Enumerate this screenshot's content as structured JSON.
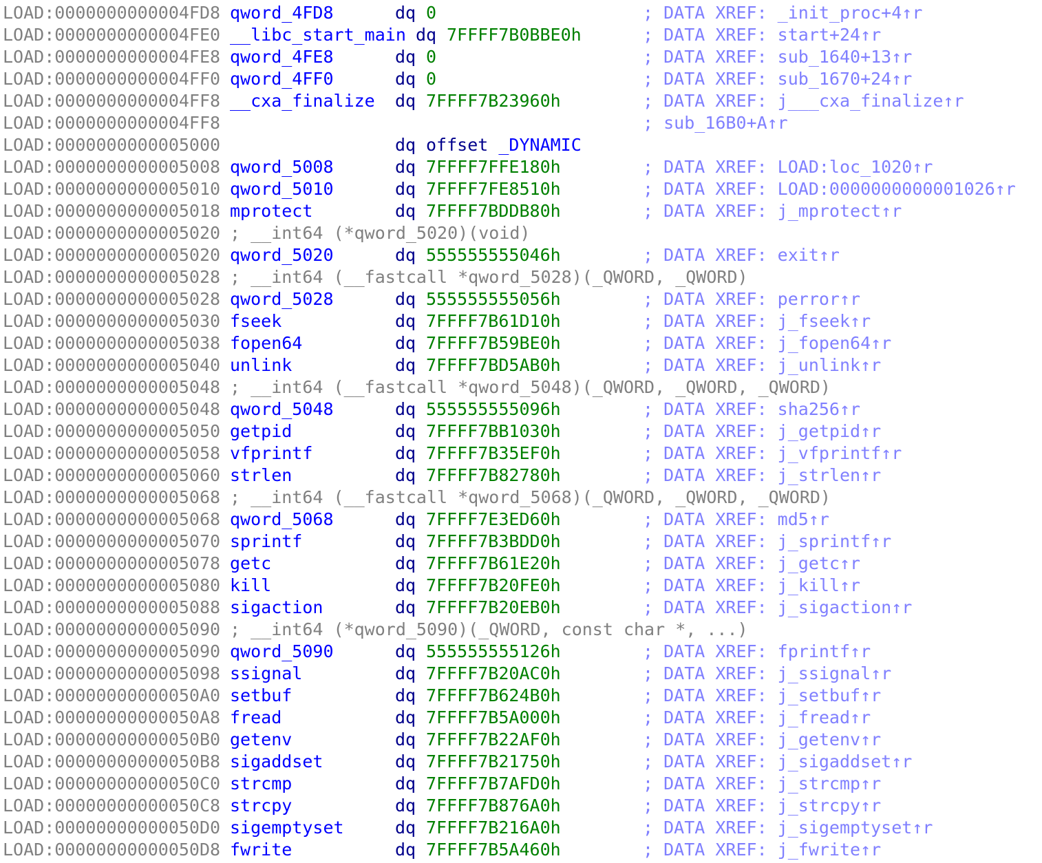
{
  "colors": {
    "background": "#ffffff",
    "address": "#808080",
    "symbol_name": "#0000ff",
    "mnemonic": "#00008c",
    "number": "#008000",
    "comment": "#808080",
    "xref": "#8080ff"
  },
  "lines": [
    {
      "addr": "LOAD:0000000000004FD8",
      "name": "qword_4FD8",
      "mnem": "dq",
      "oper": "0",
      "xref": "; DATA XREF: _init_proc+4↑r"
    },
    {
      "addr": "LOAD:0000000000004FE0",
      "name": "__libc_start_main",
      "mnem": "dq",
      "oper": "7FFFF7B0BBE0h",
      "xref": "; DATA XREF: start+24↑r",
      "wide": true
    },
    {
      "addr": "LOAD:0000000000004FE8",
      "name": "qword_4FE8",
      "mnem": "dq",
      "oper": "0",
      "xref": "; DATA XREF: sub_1640+13↑r"
    },
    {
      "addr": "LOAD:0000000000004FF0",
      "name": "qword_4FF0",
      "mnem": "dq",
      "oper": "0",
      "xref": "; DATA XREF: sub_1670+24↑r"
    },
    {
      "addr": "LOAD:0000000000004FF8",
      "name": "__cxa_finalize",
      "mnem": "dq",
      "oper": "7FFFF7B23960h",
      "xref": "; DATA XREF: j___cxa_finalize↑r"
    },
    {
      "addr": "LOAD:0000000000004FF8",
      "name": "",
      "mnem": "",
      "oper": "",
      "xref": "; sub_16B0+A↑r"
    },
    {
      "addr": "LOAD:0000000000005000",
      "name": "",
      "mnem": "dq",
      "oper_kw": "offset",
      "oper_sym": "_DYNAMIC",
      "xref": ""
    },
    {
      "addr": "LOAD:0000000000005008",
      "name": "qword_5008",
      "mnem": "dq",
      "oper": "7FFFF7FFE180h",
      "xref": "; DATA XREF: LOAD:loc_1020↑r"
    },
    {
      "addr": "LOAD:0000000000005010",
      "name": "qword_5010",
      "mnem": "dq",
      "oper": "7FFFF7FE8510h",
      "xref": "; DATA XREF: LOAD:0000000000001026↑r"
    },
    {
      "addr": "LOAD:0000000000005018",
      "name": "mprotect",
      "mnem": "dq",
      "oper": "7FFFF7BDDB80h",
      "xref": "; DATA XREF: j_mprotect↑r"
    },
    {
      "addr": "LOAD:0000000000005020",
      "comment": "; __int64 (*qword_5020)(void)"
    },
    {
      "addr": "LOAD:0000000000005020",
      "name": "qword_5020",
      "mnem": "dq",
      "oper": "555555555046h",
      "xref": "; DATA XREF: exit↑r"
    },
    {
      "addr": "LOAD:0000000000005028",
      "comment": "; __int64 (__fastcall *qword_5028)(_QWORD, _QWORD)"
    },
    {
      "addr": "LOAD:0000000000005028",
      "name": "qword_5028",
      "mnem": "dq",
      "oper": "555555555056h",
      "xref": "; DATA XREF: perror↑r"
    },
    {
      "addr": "LOAD:0000000000005030",
      "name": "fseek",
      "mnem": "dq",
      "oper": "7FFFF7B61D10h",
      "xref": "; DATA XREF: j_fseek↑r"
    },
    {
      "addr": "LOAD:0000000000005038",
      "name": "fopen64",
      "mnem": "dq",
      "oper": "7FFFF7B59BE0h",
      "xref": "; DATA XREF: j_fopen64↑r"
    },
    {
      "addr": "LOAD:0000000000005040",
      "name": "unlink",
      "mnem": "dq",
      "oper": "7FFFF7BD5AB0h",
      "xref": "; DATA XREF: j_unlink↑r"
    },
    {
      "addr": "LOAD:0000000000005048",
      "comment": "; __int64 (__fastcall *qword_5048)(_QWORD, _QWORD, _QWORD)"
    },
    {
      "addr": "LOAD:0000000000005048",
      "name": "qword_5048",
      "mnem": "dq",
      "oper": "555555555096h",
      "xref": "; DATA XREF: sha256↑r"
    },
    {
      "addr": "LOAD:0000000000005050",
      "name": "getpid",
      "mnem": "dq",
      "oper": "7FFFF7BB1030h",
      "xref": "; DATA XREF: j_getpid↑r"
    },
    {
      "addr": "LOAD:0000000000005058",
      "name": "vfprintf",
      "mnem": "dq",
      "oper": "7FFFF7B35EF0h",
      "xref": "; DATA XREF: j_vfprintf↑r"
    },
    {
      "addr": "LOAD:0000000000005060",
      "name": "strlen",
      "mnem": "dq",
      "oper": "7FFFF7B82780h",
      "xref": "; DATA XREF: j_strlen↑r"
    },
    {
      "addr": "LOAD:0000000000005068",
      "comment": "; __int64 (__fastcall *qword_5068)(_QWORD, _QWORD, _QWORD)"
    },
    {
      "addr": "LOAD:0000000000005068",
      "name": "qword_5068",
      "mnem": "dq",
      "oper": "7FFFF7E3ED60h",
      "xref": "; DATA XREF: md5↑r"
    },
    {
      "addr": "LOAD:0000000000005070",
      "name": "sprintf",
      "mnem": "dq",
      "oper": "7FFFF7B3BDD0h",
      "xref": "; DATA XREF: j_sprintf↑r"
    },
    {
      "addr": "LOAD:0000000000005078",
      "name": "getc",
      "mnem": "dq",
      "oper": "7FFFF7B61E20h",
      "xref": "; DATA XREF: j_getc↑r"
    },
    {
      "addr": "LOAD:0000000000005080",
      "name": "kill",
      "mnem": "dq",
      "oper": "7FFFF7B20FE0h",
      "xref": "; DATA XREF: j_kill↑r"
    },
    {
      "addr": "LOAD:0000000000005088",
      "name": "sigaction",
      "mnem": "dq",
      "oper": "7FFFF7B20EB0h",
      "xref": "; DATA XREF: j_sigaction↑r"
    },
    {
      "addr": "LOAD:0000000000005090",
      "comment": "; __int64 (*qword_5090)(_QWORD, const char *, ...)"
    },
    {
      "addr": "LOAD:0000000000005090",
      "name": "qword_5090",
      "mnem": "dq",
      "oper": "555555555126h",
      "xref": "; DATA XREF: fprintf↑r"
    },
    {
      "addr": "LOAD:0000000000005098",
      "name": "ssignal",
      "mnem": "dq",
      "oper": "7FFFF7B20AC0h",
      "xref": "; DATA XREF: j_ssignal↑r"
    },
    {
      "addr": "LOAD:00000000000050A0",
      "name": "setbuf",
      "mnem": "dq",
      "oper": "7FFFF7B624B0h",
      "xref": "; DATA XREF: j_setbuf↑r"
    },
    {
      "addr": "LOAD:00000000000050A8",
      "name": "fread",
      "mnem": "dq",
      "oper": "7FFFF7B5A000h",
      "xref": "; DATA XREF: j_fread↑r"
    },
    {
      "addr": "LOAD:00000000000050B0",
      "name": "getenv",
      "mnem": "dq",
      "oper": "7FFFF7B22AF0h",
      "xref": "; DATA XREF: j_getenv↑r"
    },
    {
      "addr": "LOAD:00000000000050B8",
      "name": "sigaddset",
      "mnem": "dq",
      "oper": "7FFFF7B21750h",
      "xref": "; DATA XREF: j_sigaddset↑r"
    },
    {
      "addr": "LOAD:00000000000050C0",
      "name": "strcmp",
      "mnem": "dq",
      "oper": "7FFFF7B7AFD0h",
      "xref": "; DATA XREF: j_strcmp↑r"
    },
    {
      "addr": "LOAD:00000000000050C8",
      "name": "strcpy",
      "mnem": "dq",
      "oper": "7FFFF7B876A0h",
      "xref": "; DATA XREF: j_strcpy↑r"
    },
    {
      "addr": "LOAD:00000000000050D0",
      "name": "sigemptyset",
      "mnem": "dq",
      "oper": "7FFFF7B216A0h",
      "xref": "; DATA XREF: j_sigemptyset↑r"
    },
    {
      "addr": "LOAD:00000000000050D8",
      "name": "fwrite",
      "mnem": "dq",
      "oper": "7FFFF7B5A460h",
      "xref": "; DATA XREF: j_fwrite↑r"
    }
  ]
}
